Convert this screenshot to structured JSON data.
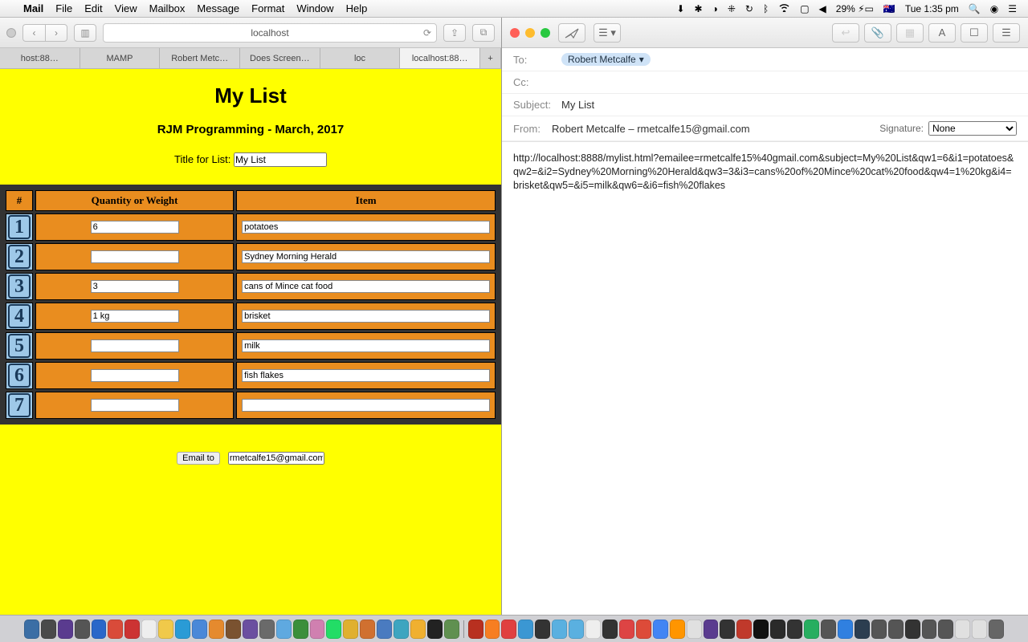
{
  "menubar": {
    "app": "Mail",
    "items": [
      "File",
      "Edit",
      "View",
      "Mailbox",
      "Message",
      "Format",
      "Window",
      "Help"
    ],
    "battery": "29%",
    "clock": "Tue 1:35 pm"
  },
  "safari": {
    "url": "localhost",
    "tabs": [
      "host:88…",
      "MAMP",
      "Robert Metc…",
      "Does Screen…",
      "loc",
      "localhost:88…"
    ],
    "activeTab": 5
  },
  "mylist": {
    "title": "My List",
    "subtitle": "RJM Programming - March, 2017",
    "titleLabel": "Title for List:",
    "titleValue": "My List",
    "cols": {
      "num": "#",
      "qty": "Quantity or Weight",
      "item": "Item"
    },
    "rows": [
      {
        "n": "1",
        "qty": "6",
        "item": "potatoes"
      },
      {
        "n": "2",
        "qty": "",
        "item": "Sydney Morning Herald"
      },
      {
        "n": "3",
        "qty": "3",
        "item": "cans of Mince cat food"
      },
      {
        "n": "4",
        "qty": "1 kg",
        "item": "brisket"
      },
      {
        "n": "5",
        "qty": "",
        "item": "milk"
      },
      {
        "n": "6",
        "qty": "",
        "item": "fish flakes"
      },
      {
        "n": "7",
        "qty": "",
        "item": ""
      }
    ],
    "emailBtn": "Email to",
    "emailValue": "rmetcalfe15@gmail.com"
  },
  "mail": {
    "toLabel": "To:",
    "toName": "Robert Metcalfe",
    "ccLabel": "Cc:",
    "subjectLabel": "Subject:",
    "subjectValue": "My List",
    "fromLabel": "From:",
    "fromValue": "Robert Metcalfe – rmetcalfe15@gmail.com",
    "sigLabel": "Signature:",
    "sigValue": "None",
    "body": "http://localhost:8888/mylist.html?emailee=rmetcalfe15%40gmail.com&subject=My%20List&qw1=6&i1=potatoes&qw2=&i2=Sydney%20Morning%20Herald&qw3=3&i3=cans%20of%20Mince%20cat%20food&qw4=1%20kg&i4=brisket&qw5=&i5=milk&qw6=&i6=fish%20flakes"
  },
  "dockColors": [
    "#3b6ea5",
    "#4a4a4a",
    "#5a3b8f",
    "#555",
    "#2a67c9",
    "#d94b3a",
    "#c33",
    "#eee",
    "#f0c94a",
    "#2a9bd6",
    "#4a88d8",
    "#e58a2e",
    "#7a5230",
    "#6b4fa0",
    "#6a6a6a",
    "#5fa9e0",
    "#3b8f3b",
    "#d080b0",
    "#2d6",
    "#e0b030",
    "#d07030",
    "#4a7bc0",
    "#3da5c0",
    "#f0b030",
    "#222",
    "#609050",
    "#b83020",
    "#f77e22",
    "#e04040",
    "#3b97d3",
    "#333",
    "#5ab0e0",
    "#5ab0e0",
    "#eee",
    "#333",
    "#d44",
    "#dd4b39",
    "#4285f4",
    "#ff9500",
    "#e0e0e0",
    "#5a3b8f",
    "#333",
    "#c0392b",
    "#111",
    "#2a2a2a",
    "#333",
    "#27ae60",
    "#555",
    "#3080e0",
    "#2c3e50",
    "#555",
    "#555",
    "#333",
    "#555",
    "#555",
    "#e0e0e0",
    "#e0e0e0",
    "#666"
  ]
}
